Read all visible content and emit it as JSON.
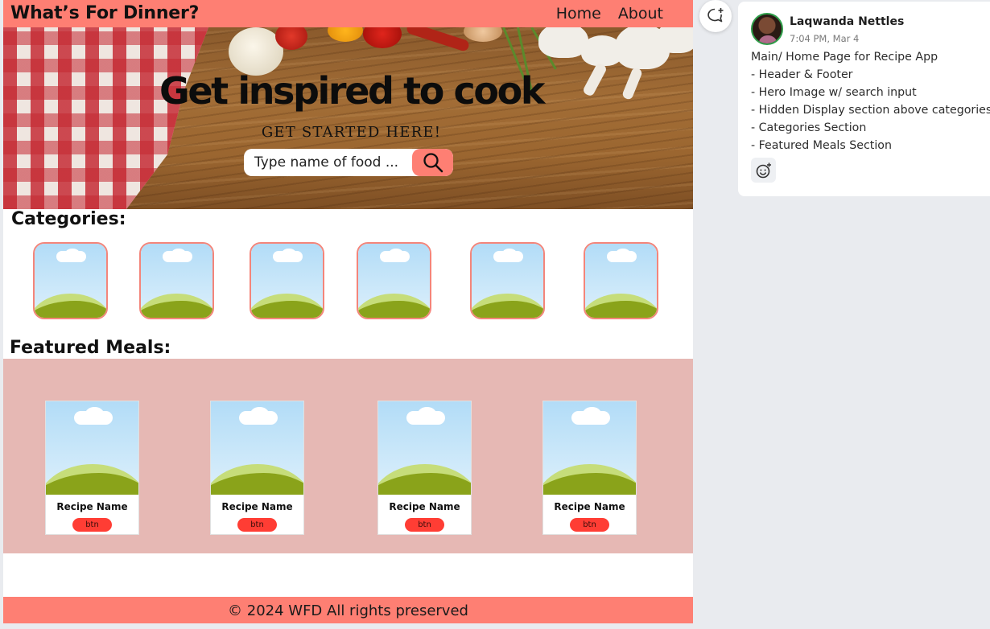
{
  "header": {
    "logo": "What’s For Dinner?",
    "nav": [
      "Home",
      "About"
    ]
  },
  "hero": {
    "title": "Get inspired to cook",
    "subtitle": "GET STARTED HERE!",
    "search_placeholder": "Type name of food ...",
    "search_icon": "search-icon"
  },
  "categories": {
    "title": "Categories:",
    "count": 6
  },
  "featured": {
    "title": "Featured Meals:",
    "cards": [
      {
        "name": "Recipe Name",
        "button": "btn"
      },
      {
        "name": "Recipe Name",
        "button": "btn"
      },
      {
        "name": "Recipe Name",
        "button": "btn"
      },
      {
        "name": "Recipe Name",
        "button": "btn"
      }
    ]
  },
  "footer": {
    "text": "© 2024 WFD All rights preserved"
  },
  "comment": {
    "author": "Laqwanda Nettles",
    "timestamp": "7:04 PM, Mar 4",
    "lines": [
      "Main/ Home Page for Recipe App",
      "- Header & Footer",
      "- Hero Image w/ search input",
      "- Hidden Display section above categories",
      "- Categories Section",
      "- Featured Meals Section"
    ],
    "add_comment_icon": "add-comment-icon",
    "reaction_icon": "add-reaction-icon"
  },
  "colors": {
    "header": "#fe7f73",
    "featured_bg": "#e6b8b4",
    "button": "#ff3d34",
    "category_border": "#f4857a",
    "panel_bg": "#e9ebef"
  }
}
